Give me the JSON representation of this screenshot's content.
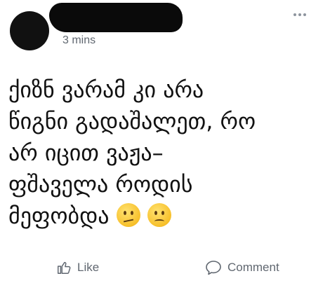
{
  "post": {
    "time": "3 mins",
    "text_lines": [
      "ქიზნ ვარამ კი არა",
      "წიგნი გადაშალეთ, რო",
      "არ იცით ვაჟა–",
      "ფშაველა როდის",
      "მეფობდა"
    ],
    "emoji_icons": [
      "confused-face-icon",
      "frowning-face-icon"
    ]
  },
  "actions": {
    "like_label": "Like",
    "comment_label": "Comment"
  },
  "colors": {
    "secondary_text": "#606770",
    "icon_gray": "#8d949e"
  }
}
